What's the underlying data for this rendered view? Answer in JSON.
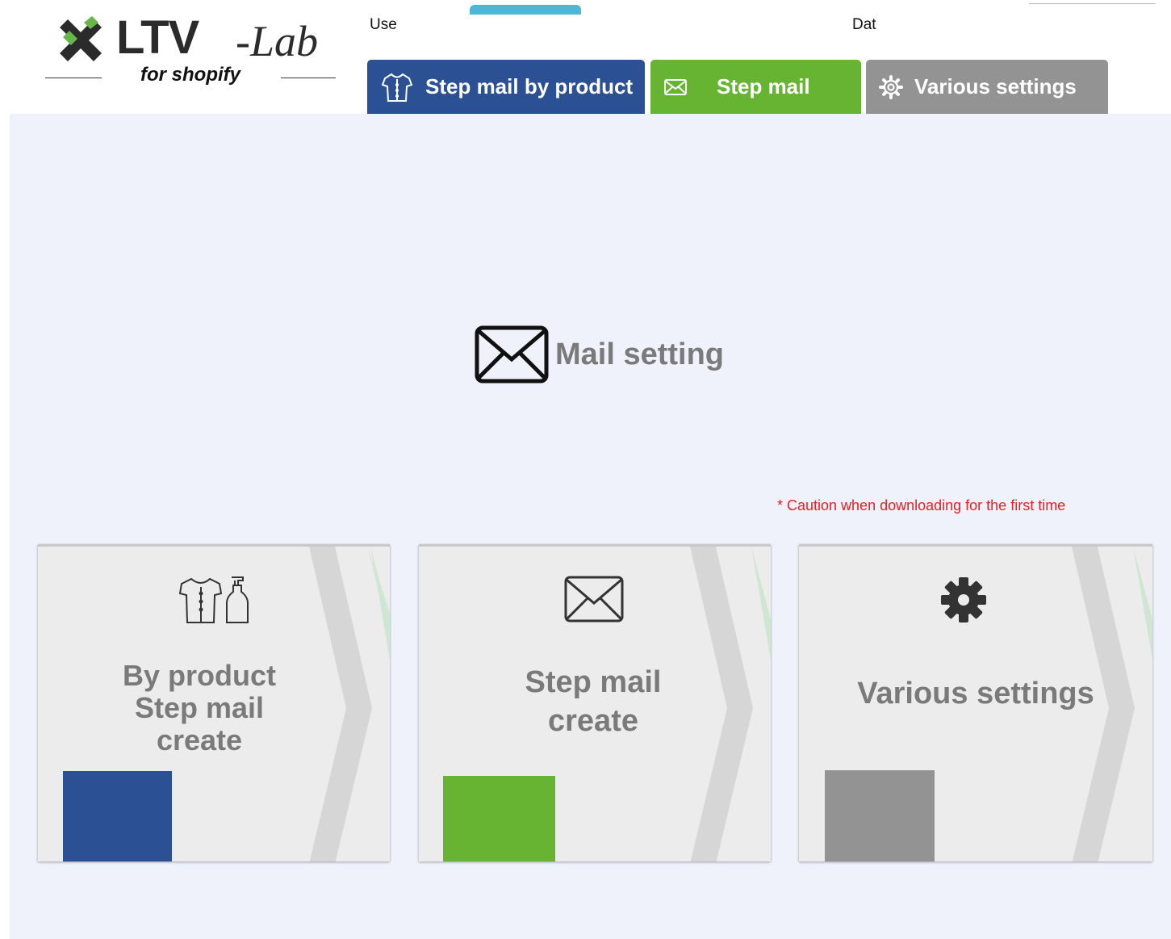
{
  "brand": {
    "name_main": "LTV",
    "name_suffix": "-Lab",
    "tagline": "for shopify"
  },
  "header": {
    "left_label": "Use",
    "right_label": "Dat"
  },
  "tabs": [
    {
      "label": "Step mail by product",
      "icon": "shirt-icon",
      "color": "#2b5094"
    },
    {
      "label": "Step mail",
      "icon": "envelope-icon",
      "color": "#66b432"
    },
    {
      "label": "Various settings",
      "icon": "gear-icon",
      "color": "#939393"
    }
  ],
  "main": {
    "title": "Mail setting",
    "caution": "* Caution when downloading for the first time",
    "cards": [
      {
        "lines": [
          "By product",
          "Step mail",
          "create"
        ],
        "icon": "clothes-bottle-icon",
        "color": "#2b5094"
      },
      {
        "lines": [
          "Step mail",
          "create"
        ],
        "icon": "envelope-icon",
        "color": "#66b432"
      },
      {
        "lines": [
          "Various settings"
        ],
        "icon": "gear-icon",
        "color": "#939393"
      }
    ]
  }
}
